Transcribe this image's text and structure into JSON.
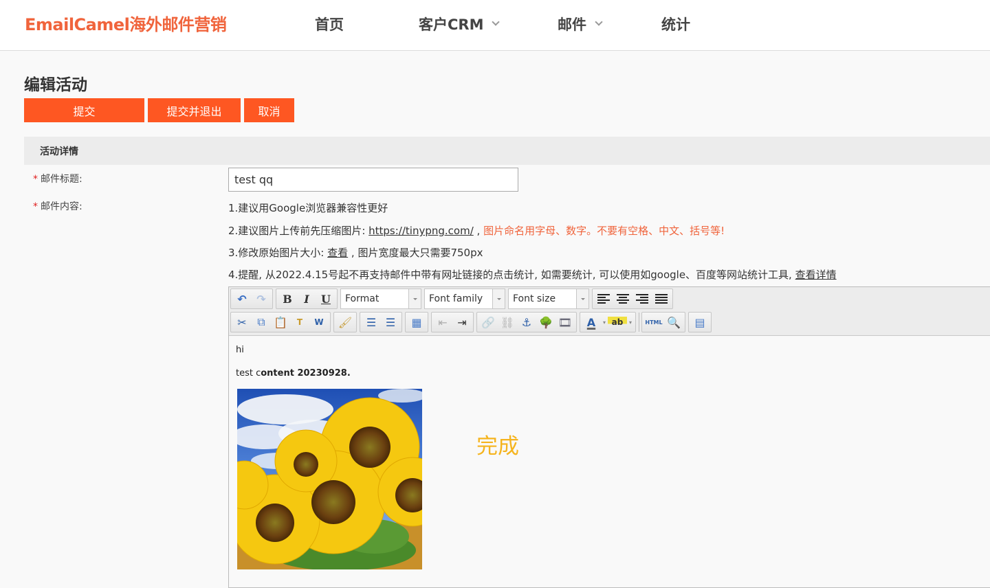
{
  "header": {
    "brand": "EmailCamel海外邮件营销",
    "nav": [
      {
        "label": "首页",
        "has_dropdown": false
      },
      {
        "label": "客户CRM",
        "has_dropdown": true
      },
      {
        "label": "邮件",
        "has_dropdown": true
      },
      {
        "label": "统计",
        "has_dropdown": false
      }
    ]
  },
  "page": {
    "title": "编辑活动",
    "buttons": {
      "submit": "提交",
      "submit_exit": "提交并退出",
      "cancel": "取消"
    }
  },
  "panel": {
    "title": "活动详情",
    "required_mark": "*",
    "subject_label": "邮件标题:",
    "subject_value": "test qq",
    "content_label": "邮件内容:",
    "tips": {
      "tip1": "1.建议用Google浏览器兼容性更好",
      "tip2_prefix": "2.建议图片上传前先压缩图片: ",
      "tip2_link": "https://tinypng.com/",
      "tip2_sep": " , ",
      "tip2_warning": "图片命名用字母、数字。不要有空格、中文、括号等!",
      "tip3_prefix": "3.修改原始图片大小: ",
      "tip3_link": "查看",
      "tip3_suffix": " , 图片宽度最大只需要750px",
      "tip4_prefix": "4.提醒, 从2022.4.15号起不再支持邮件中带有网址链接的点击统计, 如需要统计, 可以使用如google、百度等网站统计工具, ",
      "tip4_link": "查看详情"
    }
  },
  "editor": {
    "toolbar": {
      "row1": [
        "undo-icon",
        "redo-icon",
        "bold-icon",
        "italic-icon",
        "underline-icon",
        "align-left-icon",
        "align-center-icon",
        "align-right-icon",
        "align-justify-icon"
      ],
      "format_select": "Format",
      "font_family_select": "Font family",
      "font_size_select": "Font size",
      "row2": [
        "cut-icon",
        "copy-icon",
        "paste-icon",
        "paste-text-icon",
        "paste-word-icon",
        "cleanup-icon",
        "bullet-list-icon",
        "numbered-list-icon",
        "edit-table-icon",
        "outdent-icon",
        "indent-icon",
        "link-icon",
        "unlink-icon",
        "anchor-icon",
        "image-icon",
        "media-icon",
        "text-color-icon",
        "highlight-color-icon",
        "html-source-icon",
        "preview-icon",
        "template-icon"
      ],
      "labels": {
        "bold": "B",
        "italic": "I",
        "underline": "U",
        "html": "HTML",
        "text_color": "A",
        "highlight": "ab"
      }
    },
    "content": {
      "line1": "hi",
      "line2_normal": "test c",
      "line2_bold": "ontent 20230928.",
      "image_alt": "sunflowers"
    }
  },
  "overlay": {
    "done_text": "完成"
  },
  "colors": {
    "brand": "#f0643c",
    "button": "#fe5722",
    "done": "#f5b41e",
    "required": "#e02020"
  }
}
